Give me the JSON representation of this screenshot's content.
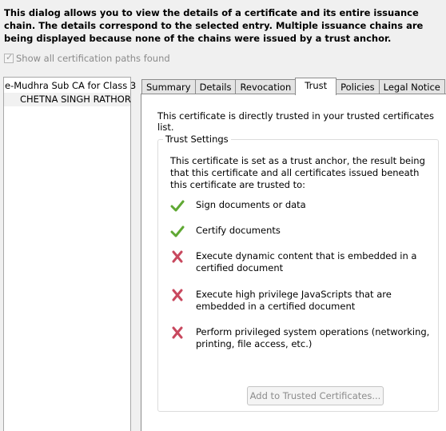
{
  "intro_text": "This dialog allows you to view the details of a certificate and its entire issuance chain. The details correspond to the selected entry. Multiple issuance chains are being displayed because none of the chains were issued by a trust anchor.",
  "show_all_paths": {
    "label": "Show all certification paths found",
    "checked": true,
    "disabled": true
  },
  "tree": {
    "items": [
      {
        "label": "e-Mudhra Sub CA for Class 3",
        "level": 0
      },
      {
        "label": "CHETNA SINGH RATHOR",
        "level": 1
      }
    ]
  },
  "tabs": [
    {
      "label": "Summary",
      "active": false
    },
    {
      "label": "Details",
      "active": false
    },
    {
      "label": "Revocation",
      "active": false
    },
    {
      "label": "Trust",
      "active": true
    },
    {
      "label": "Policies",
      "active": false
    },
    {
      "label": "Legal Notice",
      "active": false
    }
  ],
  "trust": {
    "direct_message": "This certificate is directly trusted in your trusted certificates list.",
    "group_title": "Trust Settings",
    "description": "This certificate is set as a trust anchor, the result being that this certificate and all certificates issued beneath this certificate are trusted to:",
    "permissions": [
      {
        "label": "Sign documents or data",
        "allowed": true
      },
      {
        "label": "Certify documents",
        "allowed": true
      },
      {
        "label": "Execute dynamic content that is embedded in a certified document",
        "allowed": false
      },
      {
        "label": "Execute high privilege JavaScripts that are embedded in a certified document",
        "allowed": false
      },
      {
        "label": "Perform privileged system operations (networking, printing, file access, etc.)",
        "allowed": false
      }
    ],
    "add_button_label": "Add to Trusted Certificates..."
  },
  "colors": {
    "allowed": "#5fa833",
    "denied": "#c8485e"
  }
}
